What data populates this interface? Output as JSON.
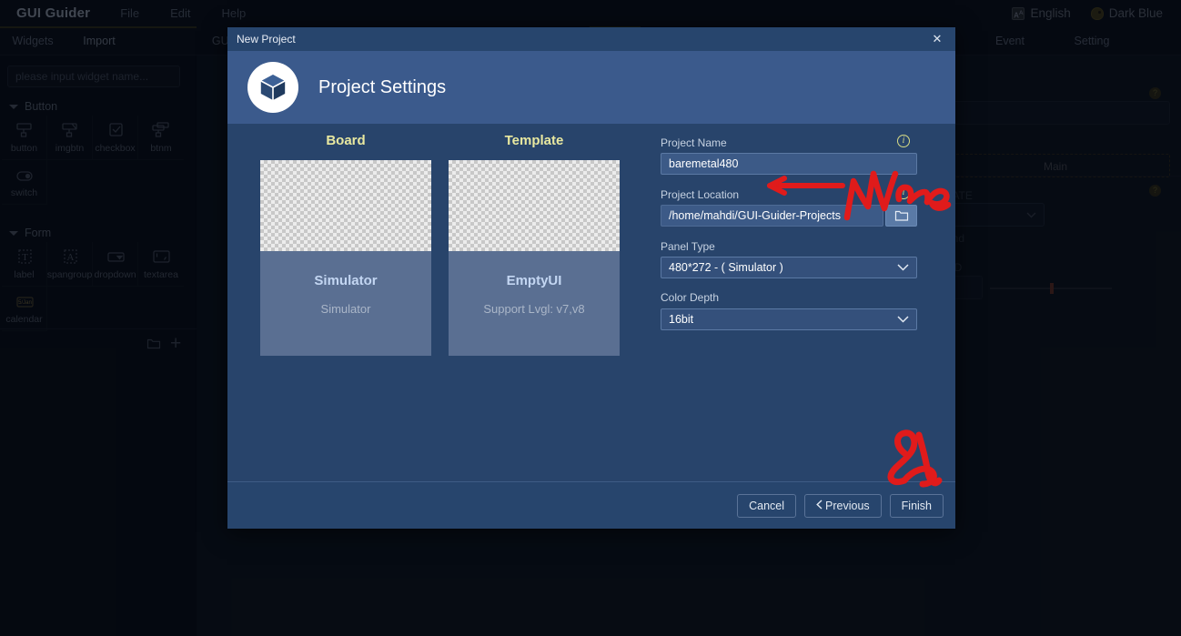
{
  "app": {
    "brand": "GUI Guider",
    "menus": [
      "File",
      "Edit",
      "Help"
    ],
    "language": "English",
    "theme": "Dark Blue",
    "language_icon": "translate-icon",
    "theme_icon": "palette-icon"
  },
  "tabs": {
    "left": [
      {
        "label": "Widgets",
        "active": false
      },
      {
        "label": "Import",
        "active": true
      }
    ],
    "center": [
      {
        "label": "GUI",
        "active": true
      }
    ],
    "right": [
      {
        "label": "Event",
        "active": false
      },
      {
        "label": "Setting",
        "active": false
      }
    ]
  },
  "sidebar": {
    "search_placeholder": "please input widget name...",
    "groups": [
      {
        "name": "Button",
        "items": [
          {
            "label": "button",
            "icon": "button-icon"
          },
          {
            "label": "imgbtn",
            "icon": "image-button-icon"
          },
          {
            "label": "checkbox",
            "icon": "checkbox-icon"
          },
          {
            "label": "btnm",
            "icon": "button-matrix-icon"
          },
          {
            "label": "switch",
            "icon": "switch-icon"
          }
        ]
      },
      {
        "name": "Form",
        "items": [
          {
            "label": "label",
            "icon": "label-icon"
          },
          {
            "label": "spangroup",
            "icon": "spangroup-icon"
          },
          {
            "label": "dropdown",
            "icon": "dropdown-icon"
          },
          {
            "label": "textarea",
            "icon": "textarea-icon"
          },
          {
            "label": "calendar",
            "icon": "calendar-icon"
          }
        ]
      }
    ],
    "footer_icons": [
      "open-folder-icon",
      "add-icon"
    ]
  },
  "properties_panel": {
    "screen_label": "te",
    "main_tab": "Main",
    "state_label": "TATE",
    "state_value": "ult",
    "background_label": "und",
    "background_section": "ND",
    "help_icon": "help-icon"
  },
  "dialog": {
    "window_title": "New Project",
    "close_icon": "close-icon",
    "logo_icon": "cube-icon",
    "title": "Project Settings",
    "columns": [
      {
        "heading": "Board"
      },
      {
        "heading": "Template"
      }
    ],
    "cards": [
      {
        "name": "Simulator",
        "sub": "Simulator"
      },
      {
        "name": "EmptyUI",
        "sub": "Support Lvgl: v7,v8"
      }
    ],
    "form": {
      "project_name": {
        "label": "Project Name",
        "value": "baremetal480",
        "info_icon": "info-icon"
      },
      "project_location": {
        "label": "Project Location",
        "value": "/home/mahdi/GUI-Guider-Projects",
        "browse_icon": "folder-icon",
        "info_icon": "info-icon"
      },
      "panel_type": {
        "label": "Panel Type",
        "value": "480*272 - ( Simulator )",
        "chevron_icon": "chevron-down-icon"
      },
      "color_depth": {
        "label": "Color Depth",
        "value": "16bit",
        "chevron_icon": "chevron-down-icon"
      }
    },
    "buttons": {
      "cancel": "Cancel",
      "previous": "Previous",
      "previous_icon": "chevron-left-icon",
      "finish": "Finish"
    }
  },
  "annotations": {
    "color": "#e01b1b",
    "name_text": "Name",
    "arrow": "left-arrow-annotation",
    "scribble": "scribble-annotation"
  }
}
